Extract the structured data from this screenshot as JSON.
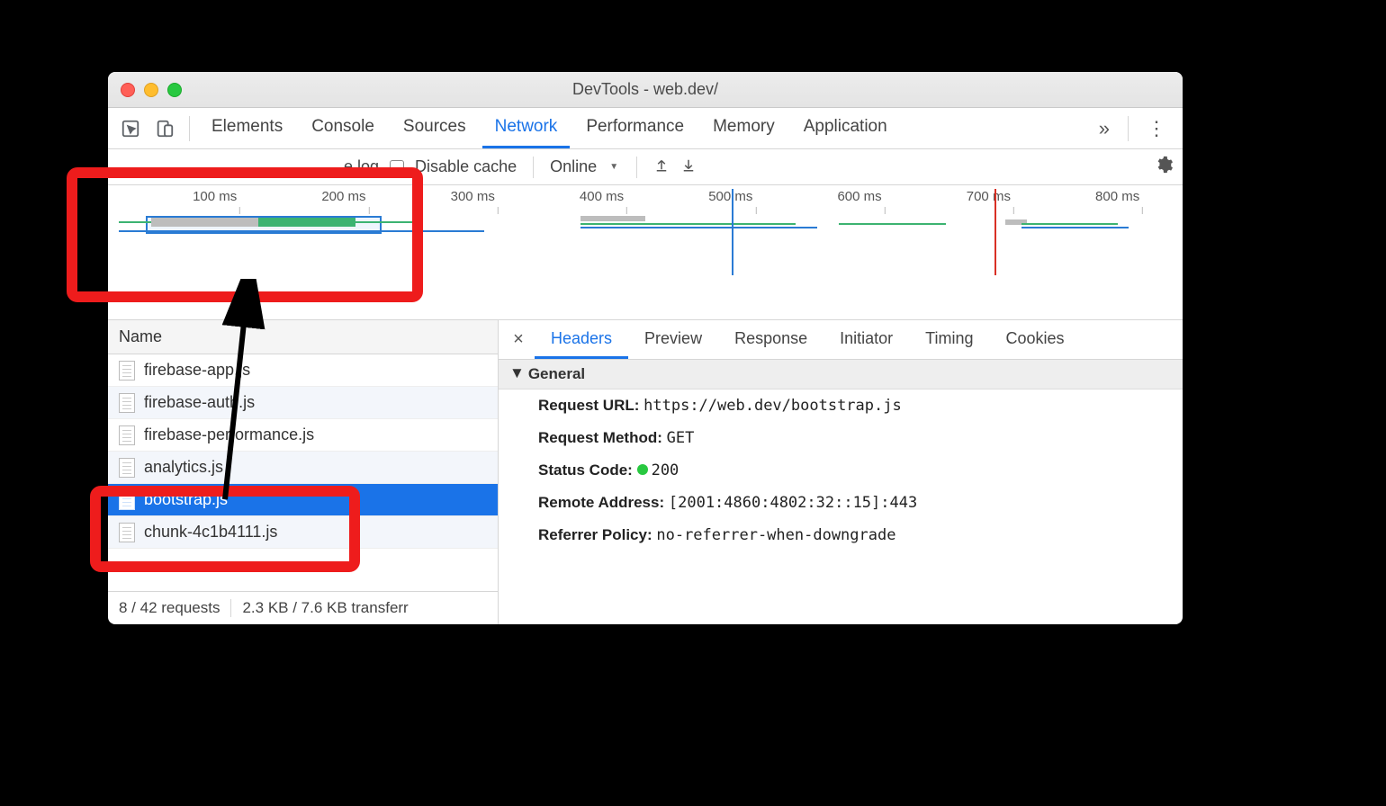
{
  "window": {
    "title": "DevTools - web.dev/"
  },
  "tabs": {
    "items": [
      "Elements",
      "Console",
      "Sources",
      "Network",
      "Performance",
      "Memory",
      "Application"
    ],
    "active": "Network",
    "overflow": "»"
  },
  "toolbar": {
    "preserve_log_label": "e log",
    "disable_cache_label": "Disable cache",
    "throttle_value": "Online"
  },
  "timeline": {
    "ticks": [
      "100 ms",
      "200 ms",
      "300 ms",
      "400 ms",
      "500 ms",
      "600 ms",
      "700 ms",
      "800 ms"
    ]
  },
  "request_table": {
    "column": "Name",
    "rows": [
      {
        "name": "firebase-app.js",
        "selected": false
      },
      {
        "name": "firebase-auth.js",
        "selected": false
      },
      {
        "name": "firebase-performance.js",
        "selected": false
      },
      {
        "name": "analytics.js",
        "selected": false
      },
      {
        "name": "bootstrap.js",
        "selected": true
      },
      {
        "name": "chunk-4c1b4111.js",
        "selected": false
      }
    ],
    "summary_requests": "8 / 42 requests",
    "summary_transfer": "2.3 KB / 7.6 KB transferr"
  },
  "detail": {
    "tabs": [
      "Headers",
      "Preview",
      "Response",
      "Initiator",
      "Timing",
      "Cookies"
    ],
    "active": "Headers",
    "section": "General",
    "request_url_label": "Request URL:",
    "request_url_value": "https://web.dev/bootstrap.js",
    "request_method_label": "Request Method:",
    "request_method_value": "GET",
    "status_code_label": "Status Code:",
    "status_code_value": "200",
    "remote_addr_label": "Remote Address:",
    "remote_addr_value": "[2001:4860:4802:32::15]:443",
    "referrer_label": "Referrer Policy:",
    "referrer_value": "no-referrer-when-downgrade"
  }
}
